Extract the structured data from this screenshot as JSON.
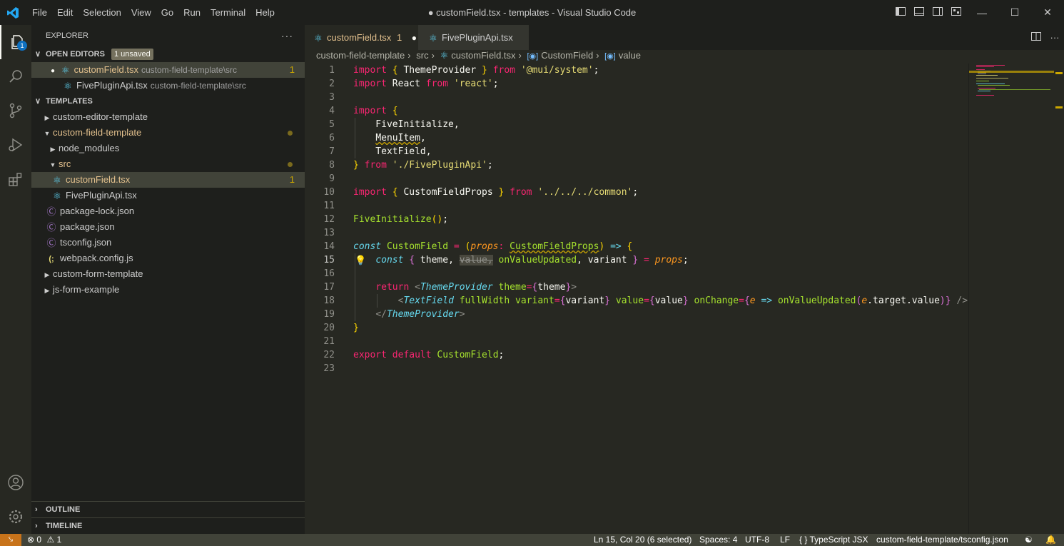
{
  "window": {
    "title": "● customField.tsx - templates - Visual Studio Code",
    "menu": [
      "File",
      "Edit",
      "Selection",
      "View",
      "Go",
      "Run",
      "Terminal",
      "Help"
    ]
  },
  "activity": {
    "explorer_badge": "1",
    "items": [
      "files-icon",
      "search-icon",
      "source-control-icon",
      "run-debug-icon",
      "extensions-icon"
    ],
    "bottom": [
      "account-icon",
      "settings-gear-icon"
    ]
  },
  "sidebar": {
    "title": "EXPLORER",
    "open_editors": {
      "label": "OPEN EDITORS",
      "badge": "1 unsaved",
      "items": [
        {
          "name": "customField.tsx",
          "path": "custom-field-template\\src",
          "problems": "1"
        },
        {
          "name": "FivePluginApi.tsx",
          "path": "custom-field-template\\src"
        }
      ]
    },
    "workspace": {
      "label": "TEMPLATES",
      "items": [
        {
          "name": "custom-editor-template"
        },
        {
          "name": "custom-field-template"
        },
        {
          "name": "node_modules"
        },
        {
          "name": "src"
        },
        {
          "name": "customField.tsx",
          "problems": "1"
        },
        {
          "name": "FivePluginApi.tsx"
        },
        {
          "name": "package-lock.json"
        },
        {
          "name": "package.json"
        },
        {
          "name": "tsconfig.json"
        },
        {
          "name": "webpack.config.js"
        },
        {
          "name": "custom-form-template"
        },
        {
          "name": "js-form-example"
        }
      ]
    },
    "outline_label": "OUTLINE",
    "timeline_label": "TIMELINE"
  },
  "tabs": [
    {
      "label": "customField.tsx",
      "problems": "1",
      "dirty": "●"
    },
    {
      "label": "FivePluginApi.tsx"
    }
  ],
  "breadcrumb": [
    "custom-field-template",
    "src",
    "customField.tsx",
    "CustomField",
    "value"
  ],
  "editor": {
    "current_line": 15,
    "line_numbers": [
      "1",
      "2",
      "3",
      "4",
      "5",
      "6",
      "7",
      "8",
      "9",
      "10",
      "11",
      "12",
      "13",
      "14",
      "15",
      "16",
      "17",
      "18",
      "19",
      "20",
      "21",
      "22",
      "23"
    ],
    "lines": [
      [
        [
          "k",
          "import"
        ],
        [
          "t",
          " "
        ],
        [
          "y",
          "{"
        ],
        [
          "t",
          " ThemeProvider "
        ],
        [
          "y",
          "}"
        ],
        [
          "t",
          " "
        ],
        [
          "k",
          "from"
        ],
        [
          "t",
          " "
        ],
        [
          "s",
          "'@mui/system'"
        ],
        [
          "t",
          ";"
        ]
      ],
      [
        [
          "k",
          "import"
        ],
        [
          "t",
          " React "
        ],
        [
          "k",
          "from"
        ],
        [
          "t",
          " "
        ],
        [
          "s",
          "'react'"
        ],
        [
          "t",
          ";"
        ]
      ],
      [],
      [
        [
          "k",
          "import"
        ],
        [
          "t",
          " "
        ],
        [
          "y",
          "{"
        ]
      ],
      [
        [
          "t",
          "    FiveInitialize,"
        ]
      ],
      [
        [
          "t",
          "    "
        ],
        [
          "q",
          "MenuItem"
        ],
        [
          "t",
          ","
        ]
      ],
      [
        [
          "t",
          "    TextField,"
        ]
      ],
      [
        [
          "y",
          "}"
        ],
        [
          "t",
          " "
        ],
        [
          "k",
          "from"
        ],
        [
          "t",
          " "
        ],
        [
          "s",
          "'./FivePluginApi'"
        ],
        [
          "t",
          ";"
        ]
      ],
      [],
      [
        [
          "k",
          "import"
        ],
        [
          "t",
          " "
        ],
        [
          "y",
          "{"
        ],
        [
          "t",
          " CustomFieldProps "
        ],
        [
          "y",
          "}"
        ],
        [
          "t",
          " "
        ],
        [
          "k",
          "from"
        ],
        [
          "t",
          " "
        ],
        [
          "s",
          "'../../../common'"
        ],
        [
          "t",
          ";"
        ]
      ],
      [],
      [
        [
          "f",
          "FiveInitialize"
        ],
        [
          "y",
          "()"
        ],
        [
          "t",
          ";"
        ]
      ],
      [],
      [
        [
          "c",
          "const"
        ],
        [
          "t",
          " "
        ],
        [
          "f",
          "CustomField"
        ],
        [
          "t",
          " "
        ],
        [
          "k",
          "="
        ],
        [
          "t",
          " "
        ],
        [
          "y",
          "("
        ],
        [
          "p",
          "props"
        ],
        [
          "k",
          ":"
        ],
        [
          "t",
          " "
        ],
        [
          "fq",
          "CustomFieldProps"
        ],
        [
          "y",
          ")"
        ],
        [
          "t",
          " "
        ],
        [
          "c",
          "=>"
        ],
        [
          "t",
          " "
        ],
        [
          "y",
          "{"
        ]
      ],
      [
        [
          "t",
          "    "
        ],
        [
          "c",
          "const"
        ],
        [
          "t",
          " "
        ],
        [
          "m",
          "{"
        ],
        [
          "t",
          " theme, "
        ],
        [
          "x",
          "value,"
        ],
        [
          "t",
          " "
        ],
        [
          "f",
          "onValueUpdated"
        ],
        [
          "t",
          ", variant "
        ],
        [
          "m",
          "}"
        ],
        [
          "t",
          " "
        ],
        [
          "k",
          "="
        ],
        [
          "t",
          " "
        ],
        [
          "p",
          "props"
        ],
        [
          "t",
          ";"
        ]
      ],
      [],
      [
        [
          "t",
          "    "
        ],
        [
          "k",
          "return"
        ],
        [
          "t",
          " "
        ],
        [
          "g",
          "<"
        ],
        [
          "c",
          "ThemeProvider"
        ],
        [
          "t",
          " "
        ],
        [
          "f",
          "theme"
        ],
        [
          "k",
          "="
        ],
        [
          "m",
          "{"
        ],
        [
          "t",
          "theme"
        ],
        [
          "m",
          "}"
        ],
        [
          "g",
          ">"
        ]
      ],
      [
        [
          "t",
          "        "
        ],
        [
          "g",
          "<"
        ],
        [
          "c",
          "TextField"
        ],
        [
          "t",
          " "
        ],
        [
          "f",
          "fullWidth"
        ],
        [
          "t",
          " "
        ],
        [
          "f",
          "variant"
        ],
        [
          "k",
          "="
        ],
        [
          "m",
          "{"
        ],
        [
          "t",
          "variant"
        ],
        [
          "m",
          "}"
        ],
        [
          "t",
          " "
        ],
        [
          "f",
          "value"
        ],
        [
          "k",
          "="
        ],
        [
          "m",
          "{"
        ],
        [
          "t",
          "value"
        ],
        [
          "m",
          "}"
        ],
        [
          "t",
          " "
        ],
        [
          "f",
          "onChange"
        ],
        [
          "k",
          "="
        ],
        [
          "m",
          "{"
        ],
        [
          "p",
          "e"
        ],
        [
          "t",
          " "
        ],
        [
          "c",
          "=>"
        ],
        [
          "t",
          " "
        ],
        [
          "f",
          "onValueUpdated"
        ],
        [
          "m",
          "("
        ],
        [
          "p",
          "e"
        ],
        [
          "t",
          ".target.value"
        ],
        [
          "m",
          ")"
        ],
        [
          "m",
          "}"
        ],
        [
          "t",
          " "
        ],
        [
          "g",
          "/>"
        ]
      ],
      [
        [
          "t",
          "    "
        ],
        [
          "g",
          "</"
        ],
        [
          "c",
          "ThemeProvider"
        ],
        [
          "g",
          ">"
        ]
      ],
      [
        [
          "y",
          "}"
        ]
      ],
      [],
      [
        [
          "k",
          "export"
        ],
        [
          "t",
          " "
        ],
        [
          "k",
          "default"
        ],
        [
          "t",
          " "
        ],
        [
          "f",
          "CustomField"
        ],
        [
          "t",
          ";"
        ]
      ],
      []
    ]
  },
  "status": {
    "errors": "0",
    "warnings": "1",
    "position": "Ln 15, Col 20 (6 selected)",
    "spaces": "Spaces: 4",
    "encoding": "UTF-8",
    "eol": "LF",
    "language": "TypeScript JSX",
    "tsconfig": "custom-field-template/tsconfig.json"
  },
  "colors": {
    "accent_blue": "#0e70c0",
    "modified_text": "#e2c08d",
    "status_bar": "#414339",
    "remote_button": "#c8731a"
  }
}
